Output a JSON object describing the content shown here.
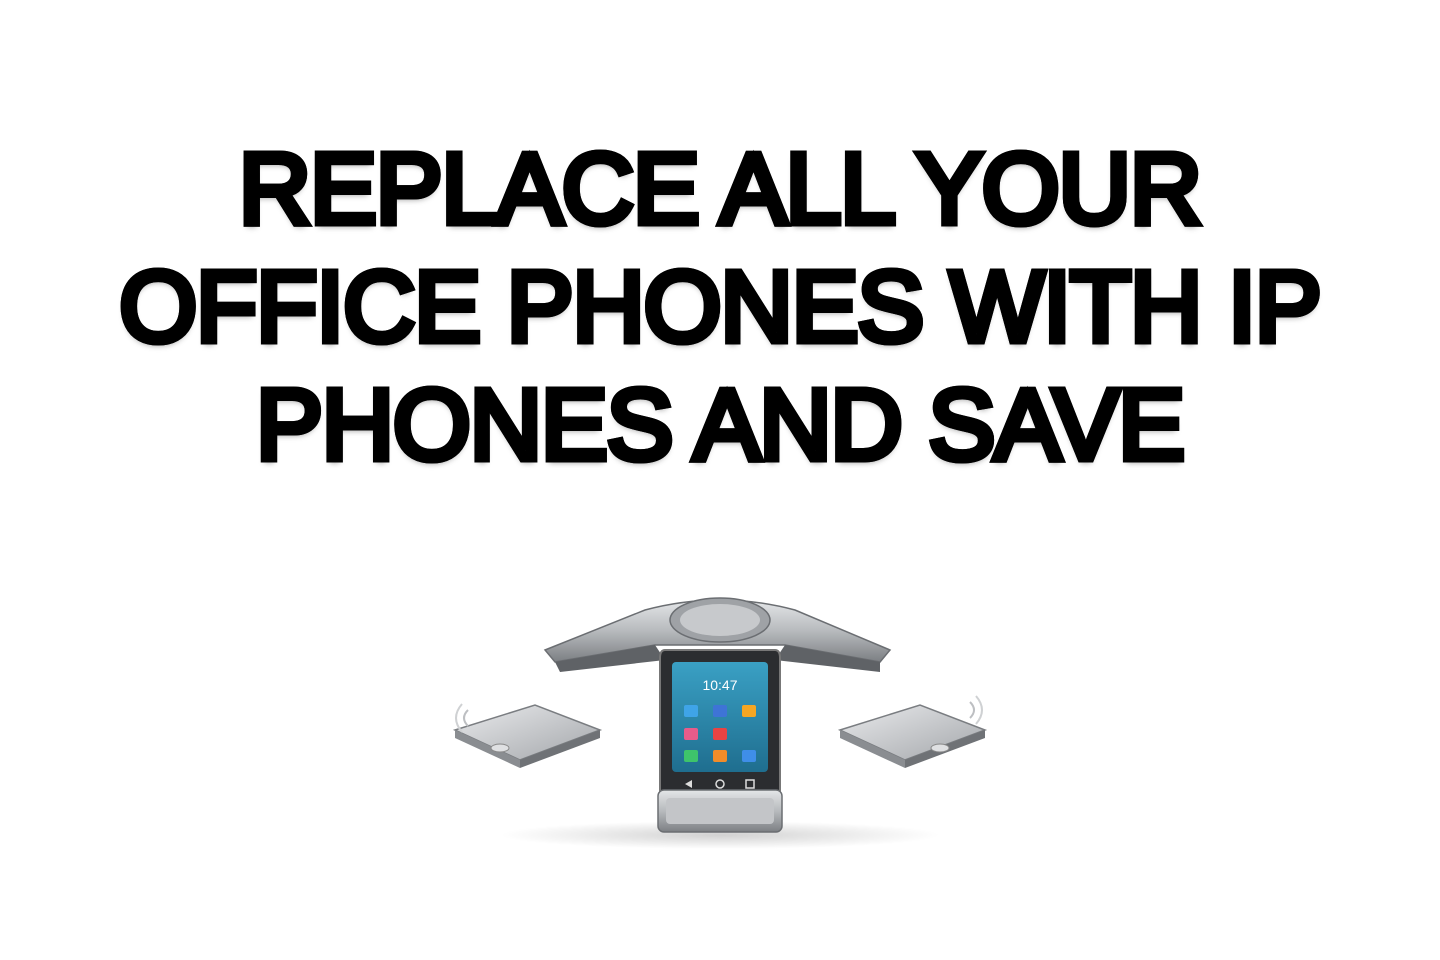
{
  "headline": {
    "lines": [
      "REPLACE ALL YOUR",
      "OFFICE PHONES WITH IP",
      "PHONES AND SAVE"
    ]
  },
  "product": {
    "screen_time": "10:47",
    "icons": [
      "wireless-signal-icon",
      "wireless-signal-icon"
    ],
    "colors": {
      "body": "#b9bcc0",
      "body_dark": "#6d7074",
      "screen": "#2f8fb0",
      "text": "#1b1b1b"
    }
  }
}
